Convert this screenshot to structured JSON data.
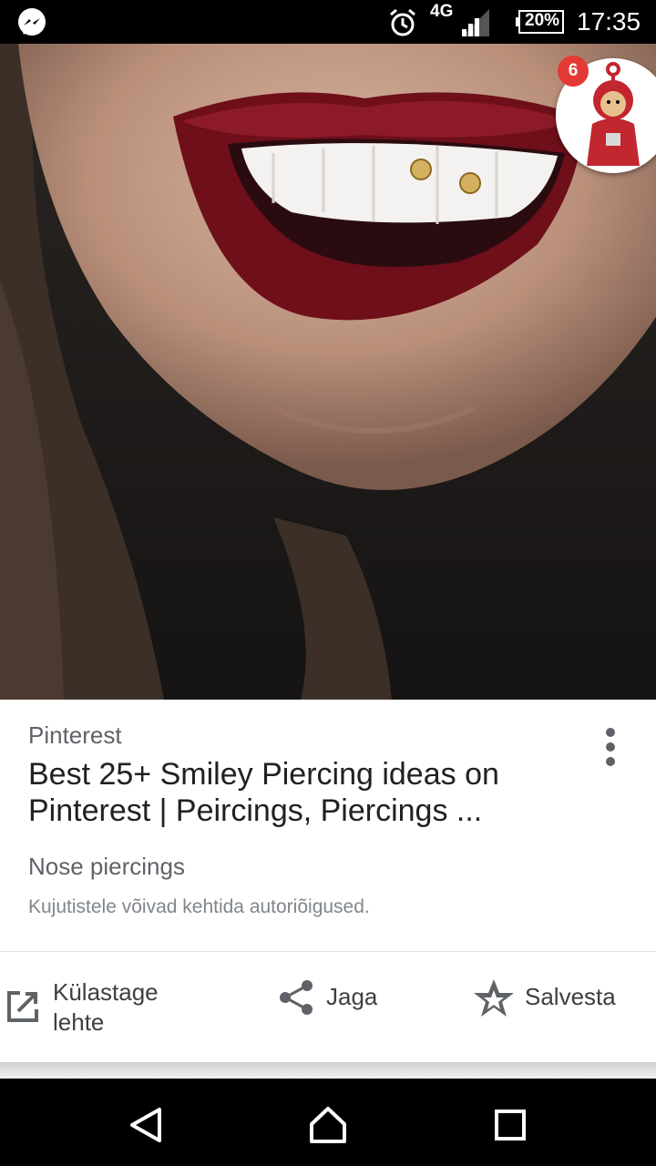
{
  "status_bar": {
    "network": "4G",
    "battery": "20%",
    "time": "17:35",
    "icons": [
      "messenger-icon",
      "alarm-icon",
      "signal-icon",
      "battery-icon"
    ]
  },
  "chat_head": {
    "badge_count": "6"
  },
  "card": {
    "source": "Pinterest",
    "title": "Best 25+ Smiley Piercing ideas on Pinterest | Peircings, Piercings ...",
    "subtitle": "Nose piercings",
    "copyright": "Kujutistele võivad kehtida autoriõigused.",
    "actions": {
      "visit_label_line1": "Külastage",
      "visit_label_line2": "lehte",
      "share_label": "Jaga",
      "save_label": "Salvesta"
    }
  },
  "colors": {
    "badge": "#e53935",
    "text_primary": "#202124",
    "text_secondary": "#5f6368"
  }
}
